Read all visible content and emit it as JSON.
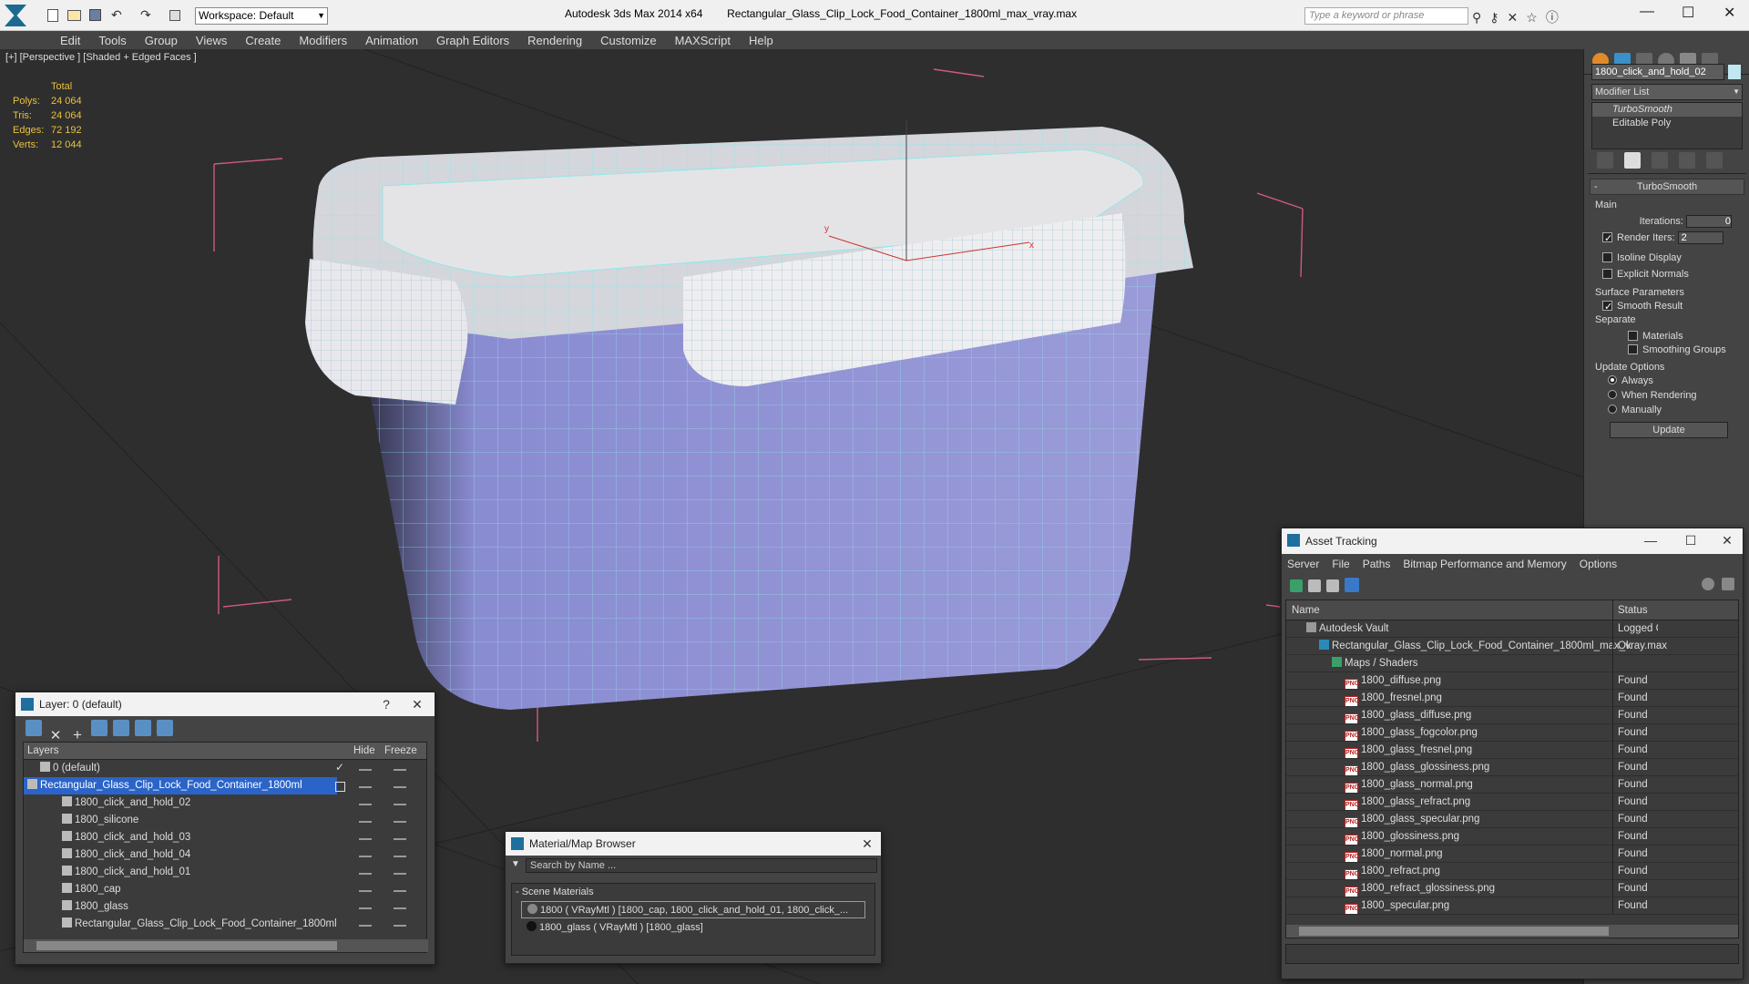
{
  "app": {
    "title": "Autodesk 3ds Max  2014 x64",
    "file": "Rectangular_Glass_Clip_Lock_Food_Container_1800ml_max_vray.max",
    "workspace": "Workspace: Default",
    "search_placeholder": "Type a keyword or phrase"
  },
  "menu": [
    "Edit",
    "Tools",
    "Group",
    "Views",
    "Create",
    "Modifiers",
    "Animation",
    "Graph Editors",
    "Rendering",
    "Customize",
    "MAXScript",
    "Help"
  ],
  "viewport": {
    "label": "[+] [Perspective ] [Shaded + Edged Faces ]",
    "stats": {
      "header": "Total",
      "rows": [
        {
          "label": "Polys:",
          "value": "24 064"
        },
        {
          "label": "Tris:",
          "value": "24 064"
        },
        {
          "label": "Edges:",
          "value": "72 192"
        },
        {
          "label": "Verts:",
          "value": "12 044"
        }
      ]
    },
    "axis_x": "x",
    "axis_y": "y"
  },
  "cmd": {
    "object_name": "1800_click_and_hold_02",
    "modifier_list": "Modifier List",
    "stack": [
      "TurboSmooth",
      "Editable Poly"
    ],
    "rollout_title": "TurboSmooth",
    "main": "Main",
    "iterations_label": "Iterations:",
    "iterations": "0",
    "render_iters_label": "Render Iters:",
    "render_iters": "2",
    "isoline": "Isoline Display",
    "explicit": "Explicit Normals",
    "surface": "Surface Parameters",
    "smooth": "Smooth Result",
    "separate": "Separate",
    "materials": "Materials",
    "smoothing": "Smoothing Groups",
    "update_options": "Update Options",
    "always": "Always",
    "when_rendering": "When Rendering",
    "manually": "Manually",
    "update": "Update"
  },
  "layers": {
    "title": "Layer: 0 (default)",
    "help": "?",
    "col_layers": "Layers",
    "col_hide": "Hide",
    "col_freeze": "Freeze",
    "rows": [
      "0 (default)",
      "Rectangular_Glass_Clip_Lock_Food_Container_1800ml",
      "1800_click_and_hold_02",
      "1800_silicone",
      "1800_click_and_hold_03",
      "1800_click_and_hold_04",
      "1800_click_and_hold_01",
      "1800_cap",
      "1800_glass",
      "Rectangular_Glass_Clip_Lock_Food_Container_1800ml"
    ]
  },
  "matbrowser": {
    "title": "Material/Map Browser",
    "search": "Search by Name ...",
    "section": "- Scene Materials",
    "items": [
      "1800  ( VRayMtl )  [1800_cap, 1800_click_and_hold_01, 1800_click_...",
      "1800_glass  ( VRayMtl )  [1800_glass]"
    ]
  },
  "asset": {
    "title": "Asset Tracking",
    "menu": [
      "Server",
      "File",
      "Paths",
      "Bitmap Performance and Memory",
      "Options"
    ],
    "col_name": "Name",
    "col_status": "Status",
    "rows": [
      {
        "name": "Autodesk Vault",
        "status": "Logged C",
        "indent": 0,
        "icon": "vault"
      },
      {
        "name": "Rectangular_Glass_Clip_Lock_Food_Container_1800ml_max_vray.max",
        "status": "Ok",
        "indent": 1,
        "icon": "max"
      },
      {
        "name": "Maps / Shaders",
        "status": "",
        "indent": 2,
        "icon": "maps"
      },
      {
        "name": "1800_diffuse.png",
        "status": "Found",
        "indent": 3,
        "icon": "png"
      },
      {
        "name": "1800_fresnel.png",
        "status": "Found",
        "indent": 3,
        "icon": "png"
      },
      {
        "name": "1800_glass_diffuse.png",
        "status": "Found",
        "indent": 3,
        "icon": "png"
      },
      {
        "name": "1800_glass_fogcolor.png",
        "status": "Found",
        "indent": 3,
        "icon": "png"
      },
      {
        "name": "1800_glass_fresnel.png",
        "status": "Found",
        "indent": 3,
        "icon": "png"
      },
      {
        "name": "1800_glass_glossiness.png",
        "status": "Found",
        "indent": 3,
        "icon": "png"
      },
      {
        "name": "1800_glass_normal.png",
        "status": "Found",
        "indent": 3,
        "icon": "png"
      },
      {
        "name": "1800_glass_refract.png",
        "status": "Found",
        "indent": 3,
        "icon": "png"
      },
      {
        "name": "1800_glass_specular.png",
        "status": "Found",
        "indent": 3,
        "icon": "png"
      },
      {
        "name": "1800_glossiness.png",
        "status": "Found",
        "indent": 3,
        "icon": "png"
      },
      {
        "name": "1800_normal.png",
        "status": "Found",
        "indent": 3,
        "icon": "png"
      },
      {
        "name": "1800_refract.png",
        "status": "Found",
        "indent": 3,
        "icon": "png"
      },
      {
        "name": "1800_refract_glossiness.png",
        "status": "Found",
        "indent": 3,
        "icon": "png"
      },
      {
        "name": "1800_specular.png",
        "status": "Found",
        "indent": 3,
        "icon": "png"
      }
    ]
  },
  "colors": {
    "accent": "#1e6f9e",
    "selection": "#2b64c8",
    "container_fill": "#8c8ed0",
    "wire": "#8fe8e8",
    "stats": "#e8c040"
  }
}
